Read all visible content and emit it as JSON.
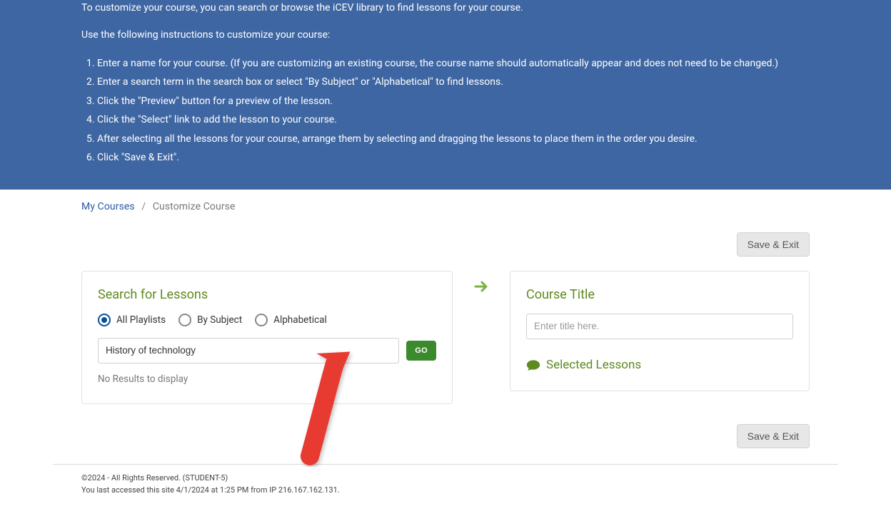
{
  "banner": {
    "intro": "To customize your course, you can search or browse the iCEV library to find lessons for your course.",
    "lead_in": "Use the following instructions to customize your course:",
    "steps": [
      "Enter a name for your course. (If you are customizing an existing course, the course name should automatically appear and does not need to be changed.)",
      "Enter a search term in the search box or select \"By Subject\" or \"Alphabetical\" to find lessons.",
      "Click the \"Preview\" button for a preview of the lesson.",
      "Click the \"Select\" link to add the lesson to your course.",
      "After selecting all the lessons for your course, arrange them by selecting and dragging the lessons to place them in the order you desire.",
      "Click \"Save & Exit\"."
    ]
  },
  "breadcrumb": {
    "my_courses": "My Courses",
    "current": "Customize Course"
  },
  "actions": {
    "save_exit": "Save & Exit"
  },
  "search_panel": {
    "heading": "Search for Lessons",
    "radios": {
      "all_playlists": "All Playlists",
      "by_subject": "By Subject",
      "alphabetical": "Alphabetical"
    },
    "search_value": "History of technology",
    "go": "GO",
    "no_results": "No Results to display"
  },
  "course_panel": {
    "heading": "Course Title",
    "title_placeholder": "Enter title here.",
    "selected_lessons": "Selected Lessons"
  },
  "footer": {
    "copyright": "©2024 - All Rights Reserved. (STUDENT-5)",
    "last_access": "You last accessed this site 4/1/2024 at 1:25 PM from IP 216.167.162.131."
  }
}
